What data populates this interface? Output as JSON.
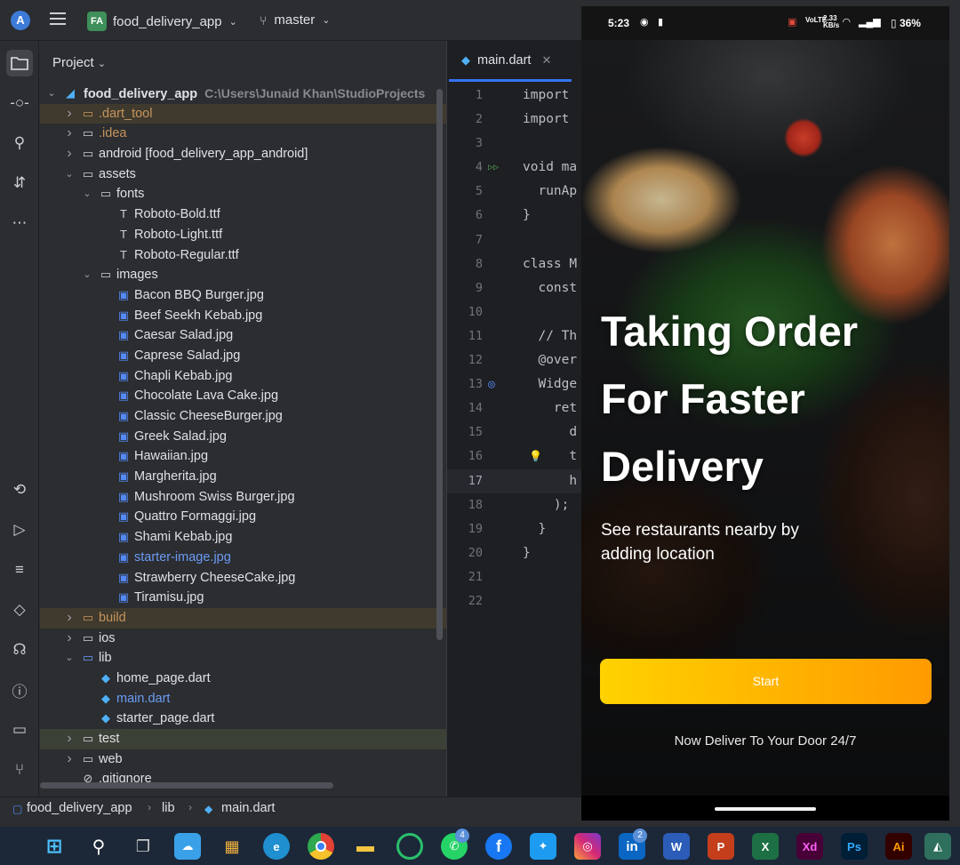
{
  "topbar": {
    "project_badge": "FA",
    "project_name": "food_delivery_app",
    "branch": "master"
  },
  "project_panel": {
    "header": "Project",
    "root_name": "food_delivery_app",
    "root_path": "C:\\Users\\Junaid Khan\\StudioProjects",
    "tree": [
      {
        "label": ".dart_tool",
        "indent": 1,
        "arrow": "›",
        "icon": "folder",
        "style": "excluded"
      },
      {
        "label": ".idea",
        "indent": 1,
        "arrow": "›",
        "icon": "folder",
        "style": "orange"
      },
      {
        "label": "android [food_delivery_app_android]",
        "indent": 1,
        "arrow": "›",
        "icon": "folder",
        "style": "module"
      },
      {
        "label": "assets",
        "indent": 1,
        "arrow": "⌄",
        "icon": "folder",
        "style": ""
      },
      {
        "label": "fonts",
        "indent": 2,
        "arrow": "⌄",
        "icon": "folder",
        "style": ""
      },
      {
        "label": "Roboto-Bold.ttf",
        "indent": 3,
        "arrow": "",
        "icon": "font",
        "style": ""
      },
      {
        "label": "Roboto-Light.ttf",
        "indent": 3,
        "arrow": "",
        "icon": "font",
        "style": ""
      },
      {
        "label": "Roboto-Regular.ttf",
        "indent": 3,
        "arrow": "",
        "icon": "font",
        "style": ""
      },
      {
        "label": "images",
        "indent": 2,
        "arrow": "⌄",
        "icon": "folder",
        "style": ""
      },
      {
        "label": "Bacon BBQ Burger.jpg",
        "indent": 3,
        "arrow": "",
        "icon": "image",
        "style": ""
      },
      {
        "label": "Beef Seekh Kebab.jpg",
        "indent": 3,
        "arrow": "",
        "icon": "image",
        "style": ""
      },
      {
        "label": "Caesar Salad.jpg",
        "indent": 3,
        "arrow": "",
        "icon": "image",
        "style": ""
      },
      {
        "label": "Caprese Salad.jpg",
        "indent": 3,
        "arrow": "",
        "icon": "image",
        "style": ""
      },
      {
        "label": "Chapli Kebab.jpg",
        "indent": 3,
        "arrow": "",
        "icon": "image",
        "style": ""
      },
      {
        "label": "Chocolate Lava Cake.jpg",
        "indent": 3,
        "arrow": "",
        "icon": "image",
        "style": ""
      },
      {
        "label": "Classic CheeseBurger.jpg",
        "indent": 3,
        "arrow": "",
        "icon": "image",
        "style": ""
      },
      {
        "label": "Greek Salad.jpg",
        "indent": 3,
        "arrow": "",
        "icon": "image",
        "style": ""
      },
      {
        "label": "Hawaiian.jpg",
        "indent": 3,
        "arrow": "",
        "icon": "image",
        "style": ""
      },
      {
        "label": "Margherita.jpg",
        "indent": 3,
        "arrow": "",
        "icon": "image",
        "style": ""
      },
      {
        "label": "Mushroom Swiss Burger.jpg",
        "indent": 3,
        "arrow": "",
        "icon": "image",
        "style": ""
      },
      {
        "label": "Quattro Formaggi.jpg",
        "indent": 3,
        "arrow": "",
        "icon": "image",
        "style": ""
      },
      {
        "label": "Shami Kebab.jpg",
        "indent": 3,
        "arrow": "",
        "icon": "image",
        "style": ""
      },
      {
        "label": "starter-image.jpg",
        "indent": 3,
        "arrow": "",
        "icon": "image",
        "style": "blue"
      },
      {
        "label": "Strawberry CheeseCake.jpg",
        "indent": 3,
        "arrow": "",
        "icon": "image",
        "style": ""
      },
      {
        "label": "Tiramisu.jpg",
        "indent": 3,
        "arrow": "",
        "icon": "image",
        "style": ""
      },
      {
        "label": "build",
        "indent": 1,
        "arrow": "›",
        "icon": "folder",
        "style": "excluded"
      },
      {
        "label": "ios",
        "indent": 1,
        "arrow": "›",
        "icon": "folder",
        "style": ""
      },
      {
        "label": "lib",
        "indent": 1,
        "arrow": "⌄",
        "icon": "folder-blue",
        "style": ""
      },
      {
        "label": "home_page.dart",
        "indent": 2,
        "arrow": "",
        "icon": "dart",
        "style": ""
      },
      {
        "label": "main.dart",
        "indent": 2,
        "arrow": "",
        "icon": "dart",
        "style": "blue"
      },
      {
        "label": "starter_page.dart",
        "indent": 2,
        "arrow": "",
        "icon": "dart",
        "style": ""
      },
      {
        "label": "test",
        "indent": 1,
        "arrow": "›",
        "icon": "folder",
        "style": "selected"
      },
      {
        "label": "web",
        "indent": 1,
        "arrow": "›",
        "icon": "folder",
        "style": ""
      },
      {
        "label": ".gitignore",
        "indent": 1,
        "arrow": "",
        "icon": "ignore",
        "style": ""
      }
    ]
  },
  "editor": {
    "tab_label": "main.dart",
    "current_line": "17",
    "lines": [
      {
        "num": "1",
        "code": "import"
      },
      {
        "num": "2",
        "code": "import"
      },
      {
        "num": "3",
        "code": ""
      },
      {
        "num": "4",
        "code": "void ma"
      },
      {
        "num": "5",
        "code": "  runAp"
      },
      {
        "num": "6",
        "code": "}"
      },
      {
        "num": "7",
        "code": ""
      },
      {
        "num": "8",
        "code": "class M"
      },
      {
        "num": "9",
        "code": "  const"
      },
      {
        "num": "10",
        "code": ""
      },
      {
        "num": "11",
        "code": "  // Th"
      },
      {
        "num": "12",
        "code": "  @over"
      },
      {
        "num": "13",
        "code": "  Widge"
      },
      {
        "num": "14",
        "code": "    ret"
      },
      {
        "num": "15",
        "code": "      d"
      },
      {
        "num": "16",
        "code": "      t"
      },
      {
        "num": "17",
        "code": "      h"
      },
      {
        "num": "18",
        "code": "    );"
      },
      {
        "num": "19",
        "code": "  }"
      },
      {
        "num": "20",
        "code": "}"
      },
      {
        "num": "21",
        "code": ""
      },
      {
        "num": "22",
        "code": ""
      }
    ]
  },
  "phone": {
    "status": {
      "time": "5:23",
      "speed": "2.33 KB/s",
      "battery": "36%"
    },
    "title_lines": [
      "Taking Order",
      "For Faster",
      "Delivery"
    ],
    "subtitle": "See restaurants nearby by adding location",
    "button": "Start",
    "footer": "Now Deliver To Your Door 24/7"
  },
  "breadcrumb": [
    "food_delivery_app",
    "lib",
    "main.dart"
  ],
  "taskbar": {
    "whatsapp_badge": "4",
    "linkedin_badge": "2",
    "apps": [
      "start",
      "search",
      "task-view",
      "weather",
      "store",
      "edge",
      "chrome",
      "file-explorer",
      "app-circle",
      "whatsapp",
      "facebook",
      "twitter",
      "instagram",
      "linkedin",
      "word",
      "powerpoint",
      "excel",
      "xd",
      "photoshop",
      "illustrator",
      "android-studio"
    ]
  },
  "colors": {
    "accent": "#3574f0",
    "start_button_from": "#ffd200",
    "start_button_to": "#ff9a00"
  }
}
